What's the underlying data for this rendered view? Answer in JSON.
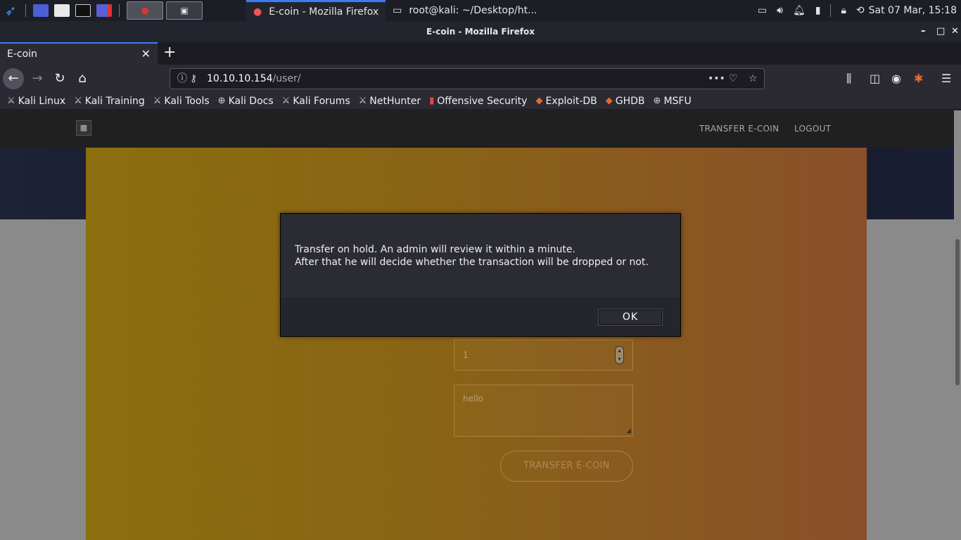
{
  "taskbar": {
    "tasks": [
      {
        "label": "E-coin - Mozilla Firefox",
        "icon": "firefox-icon"
      },
      {
        "label": "root@kali: ~/Desktop/ht...",
        "icon": "terminal-icon"
      }
    ],
    "clock": "Sat 07 Mar, 15:18"
  },
  "window": {
    "title": "E-coin - Mozilla Firefox",
    "minimize": "–",
    "maximize": "□",
    "close": "✕"
  },
  "tab": {
    "label": "E-coin",
    "close": "✕",
    "new_tab": "+"
  },
  "url": {
    "host": "10.10.10.154",
    "path": "/user/"
  },
  "bookmarks": [
    {
      "label": "Kali Linux",
      "icon": "kali-icon"
    },
    {
      "label": "Kali Training",
      "icon": "kali-icon"
    },
    {
      "label": "Kali Tools",
      "icon": "kali-icon"
    },
    {
      "label": "Kali Docs",
      "icon": "globe-icon"
    },
    {
      "label": "Kali Forums",
      "icon": "kali-icon"
    },
    {
      "label": "NetHunter",
      "icon": "kali-icon"
    },
    {
      "label": "Offensive Security",
      "icon": "offsec-icon"
    },
    {
      "label": "Exploit-DB",
      "icon": "exploitdb-icon"
    },
    {
      "label": "GHDB",
      "icon": "exploitdb-icon"
    },
    {
      "label": "MSFU",
      "icon": "globe-icon"
    }
  ],
  "site": {
    "nav": {
      "transfer": "TRANSFER E-COIN",
      "logout": "LOGOUT"
    },
    "form": {
      "amount_value": "1",
      "message_value": "hello",
      "submit_label": "TRANSFER E-COIN"
    }
  },
  "modal": {
    "line1": "Transfer on hold. An admin will review it within a minute.",
    "line2": "After that he will decide whether the transaction will be dropped or not.",
    "ok_label": "OK"
  },
  "colors": {
    "accent": "#3d7cf2",
    "card_left": "#8b6f0f",
    "card_right": "#894f2a"
  }
}
